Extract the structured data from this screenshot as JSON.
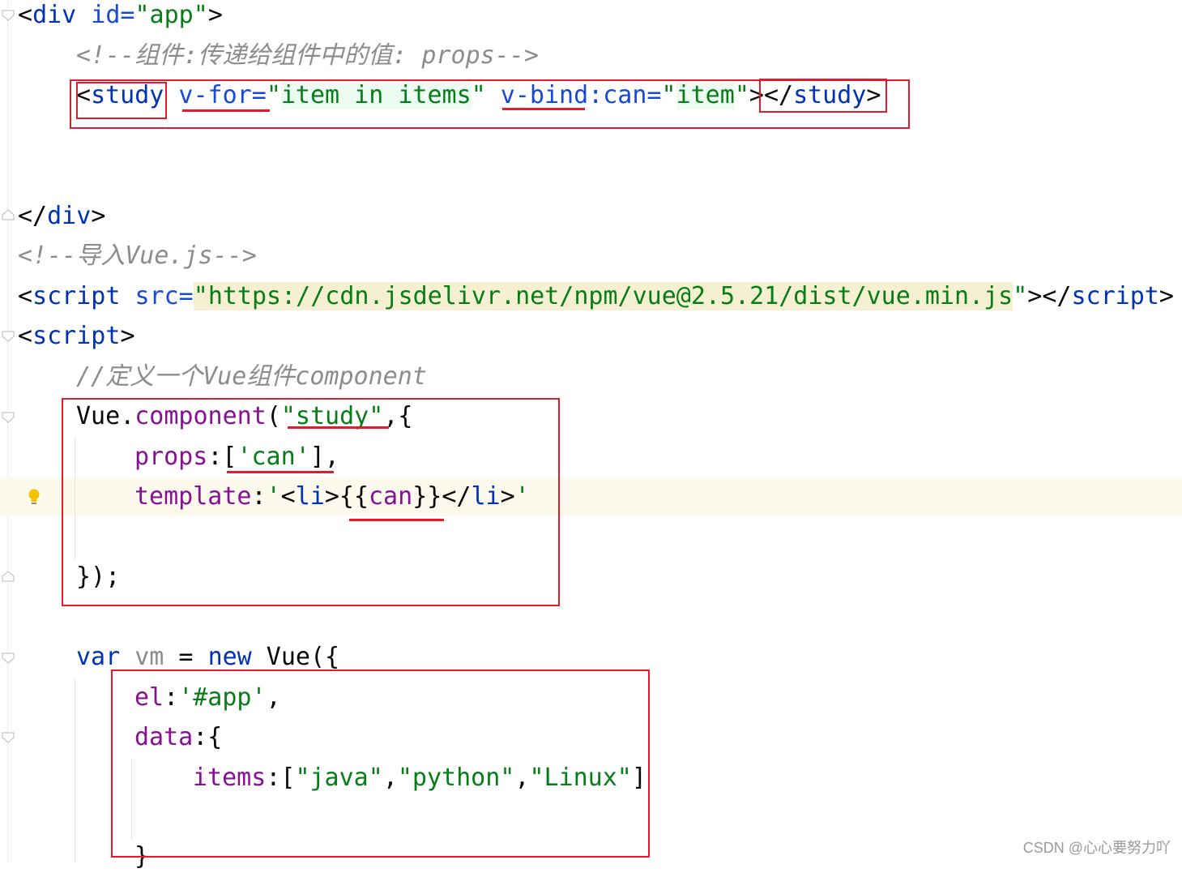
{
  "editor": {
    "lines": {
      "l1_open": "<",
      "l1_tag": "div",
      "l1_attr": " id=",
      "l1_val": "\"app\"",
      "l1_close": ">",
      "l2_comment": "<!--组件:传递给组件中的值: props-->",
      "l3_lt": "<",
      "l3_tag": "study",
      "l3_vfor": " v-for=",
      "l3_q1": "\"",
      "l3_expr": "item in items",
      "l3_q2": "\"",
      "l3_vbind": " v-bind:can=",
      "l3_q3": "\"",
      "l3_item": "item",
      "l3_q4": "\"",
      "l3_gt": ">",
      "l3_endlt": "</",
      "l3_endtag": "study",
      "l3_endgt": ">",
      "l5_open": "</",
      "l5_tag": "div",
      "l5_close": ">",
      "l6_comment": "<!--导入Vue.js-->",
      "l7_open": "<",
      "l7_tag": "script",
      "l7_attr": " src=",
      "l7_q1": "\"",
      "l7_url": "https://cdn.jsdelivr.net/npm/vue@2.5.21/dist/vue.min.js",
      "l7_q2": "\"",
      "l7_end": "></",
      "l7_endtag": "script",
      "l7_gt": ">",
      "l8_open": "<",
      "l8_tag": "script",
      "l8_close": ">",
      "l9_comment": "//定义一个Vue组件component",
      "l10_obj": "Vue",
      "l10_dot": ".",
      "l10_fn": "component",
      "l10_paren": "(",
      "l10_str": "\"study\"",
      "l10_rest": ",{",
      "l11_key": "props",
      "l11_colon": ":[",
      "l11_str": "'can'",
      "l11_end": "],",
      "l12_key": "template",
      "l12_colon": ":",
      "l12_q1": "'",
      "l12_lt": "<",
      "l12_li": "li",
      "l12_gt": ">",
      "l12_mus": "{{",
      "l12_can": "can",
      "l12_mus2": "}}",
      "l12_endlt": "</",
      "l12_endli": "li",
      "l12_endgt": ">",
      "l12_q2": "'",
      "l14_close": "});",
      "l16_var": "var",
      "l16_vm": " vm",
      "l16_eq": " = ",
      "l16_new": "new",
      "l16_vue": " Vue({",
      "l17_key": "el",
      "l17_colon": ":",
      "l17_str": "'#app'",
      "l17_comma": ",",
      "l18_key": "data",
      "l18_rest": ":{",
      "l19_key": "items",
      "l19_open": ":[",
      "l19_s1": "\"java\"",
      "l19_c1": ",",
      "l19_s2": "\"python\"",
      "l19_c2": ",",
      "l19_s3": "\"Linux\"",
      "l19_close": "]",
      "l21_close": "}"
    }
  },
  "watermark": "CSDN @心心要努力吖",
  "colors": {
    "tag": "#0033b3",
    "string": "#067d17",
    "comment": "#8c8c8c",
    "property": "#871094",
    "annotation_box": "#e8192c"
  }
}
